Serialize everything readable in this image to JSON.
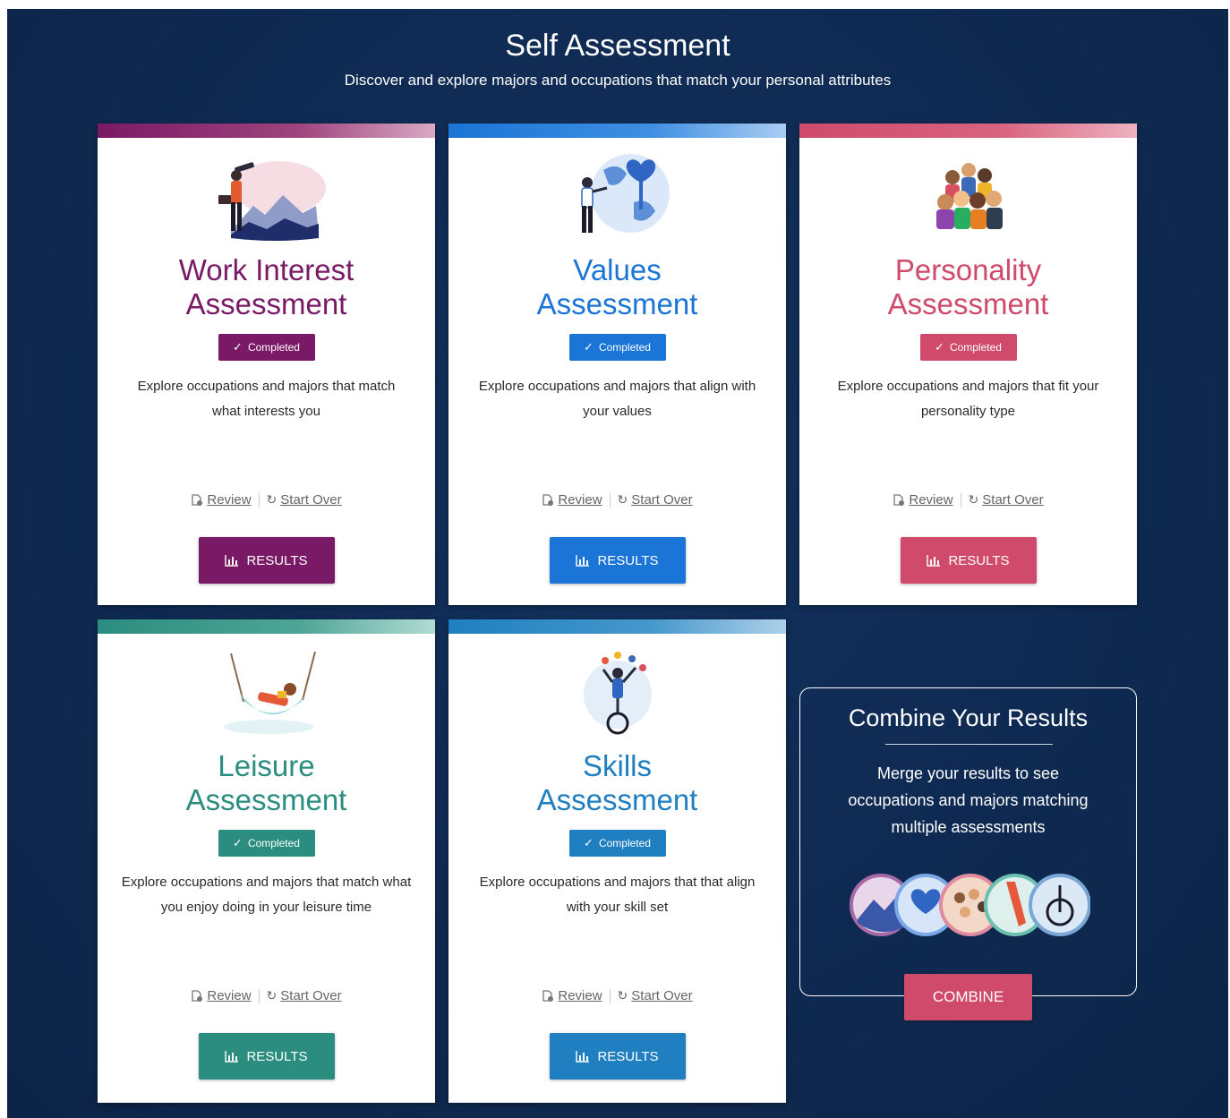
{
  "header": {
    "title": "Self Assessment",
    "subtitle": "Discover and explore majors and occupations that match your personal attributes"
  },
  "colors": {
    "background": "#0f2a52",
    "work_interest": "#7a1a66",
    "values": "#1a75d6",
    "personality": "#cf4a6b",
    "leisure": "#2a8d7f",
    "skills": "#1f7fc0"
  },
  "cards": [
    {
      "title_line1": "Work Interest",
      "title_line2": "Assessment",
      "badge": "Completed",
      "description": "Explore occupations and majors that match what interests you",
      "review": "Review",
      "start_over": "Start Over",
      "results": "RESULTS",
      "illustration": "person-with-telescope-mountains"
    },
    {
      "title_line1": "Values",
      "title_line2": "Assessment",
      "badge": "Completed",
      "description": "Explore occupations and majors that align with your values",
      "review": "Review",
      "start_over": "Start Over",
      "results": "RESULTS",
      "illustration": "person-with-globe-heart"
    },
    {
      "title_line1": "Personality",
      "title_line2": "Assessment",
      "badge": "Completed",
      "description": "Explore occupations and majors that fit your personality type",
      "review": "Review",
      "start_over": "Start Over",
      "results": "RESULTS",
      "illustration": "group-of-people"
    },
    {
      "title_line1": "Leisure",
      "title_line2": "Assessment",
      "badge": "Completed",
      "description": "Explore occupations and majors that match what you enjoy doing in your leisure time",
      "review": "Review",
      "start_over": "Start Over",
      "results": "RESULTS",
      "illustration": "person-in-hammock"
    },
    {
      "title_line1": "Skills",
      "title_line2": "Assessment",
      "badge": "Completed",
      "description": "Explore occupations and majors that that align with your skill set",
      "review": "Review",
      "start_over": "Start Over",
      "results": "RESULTS",
      "illustration": "juggler-on-unicycle"
    }
  ],
  "combine": {
    "title": "Combine Your Results",
    "description": "Merge your results to see occupations and majors matching multiple assessments",
    "button": "COMBINE"
  }
}
